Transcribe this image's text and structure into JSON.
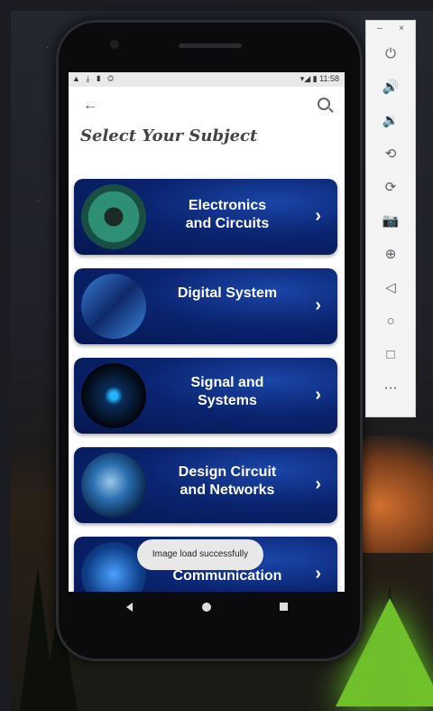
{
  "statusbar": {
    "left_icons": "▲ ⤓ ▮ ◎",
    "right_icons": "▾◢ ▮",
    "time": "11:58"
  },
  "appbar": {
    "back_icon": "arrow-back-icon",
    "search_icon": "search-icon"
  },
  "page": {
    "title": "Select Your Subject"
  },
  "subjects": [
    {
      "line1": "Electronics",
      "line2": "and Circuits",
      "thumb": "circuit-board-image"
    },
    {
      "line1": "Digital System",
      "line2": "",
      "thumb": "digital-devices-image"
    },
    {
      "line1": "Signal and",
      "line2": "Systems",
      "thumb": "signal-wave-image"
    },
    {
      "line1": "Design Circuit",
      "line2": "and Networks",
      "thumb": "network-globe-image"
    },
    {
      "line1": "",
      "line2": "Communication",
      "thumb": "communication-image"
    }
  ],
  "chevron": "›",
  "toast": {
    "text": "Image load successfully"
  },
  "navbar": {
    "back": "nav-back-icon",
    "home": "nav-home-icon",
    "recents": "nav-recents-icon"
  },
  "emulator_toolbar": {
    "minimize": "–",
    "close": "×",
    "buttons": [
      {
        "icon": "power-icon",
        "glyph": "⏻"
      },
      {
        "icon": "volume-up-icon",
        "glyph": "🔊"
      },
      {
        "icon": "volume-down-icon",
        "glyph": "🔉"
      },
      {
        "icon": "rotate-left-icon",
        "glyph": "⟲"
      },
      {
        "icon": "rotate-right-icon",
        "glyph": "⟳"
      },
      {
        "icon": "camera-icon",
        "glyph": "📷"
      },
      {
        "icon": "zoom-icon",
        "glyph": "⊕"
      },
      {
        "icon": "back-icon",
        "glyph": "◁"
      },
      {
        "icon": "home-icon",
        "glyph": "○"
      },
      {
        "icon": "overview-icon",
        "glyph": "□"
      },
      {
        "icon": "more-icon",
        "glyph": "⋯"
      }
    ]
  }
}
